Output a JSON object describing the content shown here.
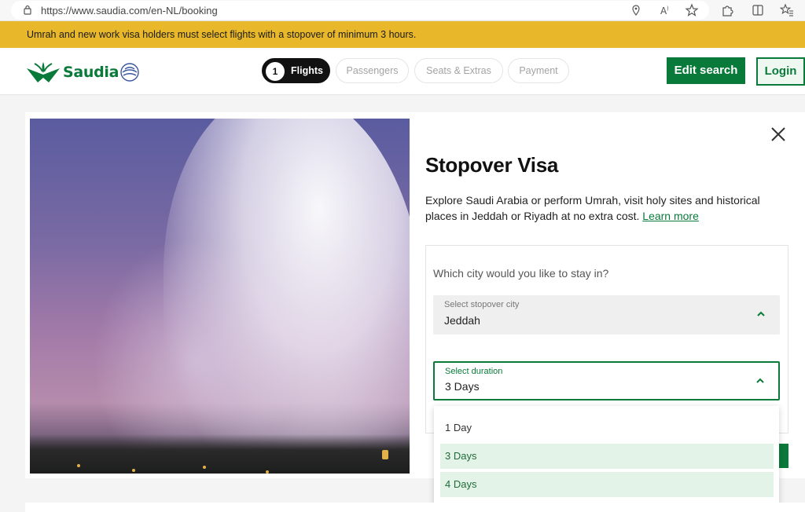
{
  "browser": {
    "url": "https://www.saudia.com/en-NL/booking",
    "icons": [
      "lock-icon",
      "location-icon",
      "read-aloud-icon",
      "favorite-star-icon",
      "extensions-icon",
      "split-screen-icon",
      "favorites-icon"
    ]
  },
  "banner": {
    "text": "Umrah and new work visa holders must select flights with a stopover of minimum 3 hours."
  },
  "header": {
    "logo_text": "Saudia",
    "steps": [
      {
        "number": "1",
        "label": "Flights",
        "active": true
      },
      {
        "label": "Passengers",
        "active": false
      },
      {
        "label": "Seats & Extras",
        "active": false
      },
      {
        "label": "Payment",
        "active": false
      }
    ],
    "edit_search_label": "Edit search",
    "login_label": "Login"
  },
  "modal": {
    "title": "Stopover Visa",
    "description": "Explore Saudi Arabia or perform Umrah, visit holy sites and historical places in Jeddah or Riyadh at no extra cost.",
    "learn_more": "Learn more",
    "question": "Which city would you like to stay in?",
    "city_select": {
      "label": "Select stopover city",
      "value": "Jeddah"
    },
    "duration_select": {
      "label": "Select duration",
      "value": "3 Days"
    },
    "duration_options": [
      {
        "label": "1 Day"
      },
      {
        "label": "3 Days",
        "selected": true
      },
      {
        "label": "4 Days",
        "hovered": true
      }
    ]
  },
  "colors": {
    "brand_green": "#0a7a3b",
    "banner_yellow": "#e9b82a",
    "option_highlight": "#e4f3e8"
  }
}
